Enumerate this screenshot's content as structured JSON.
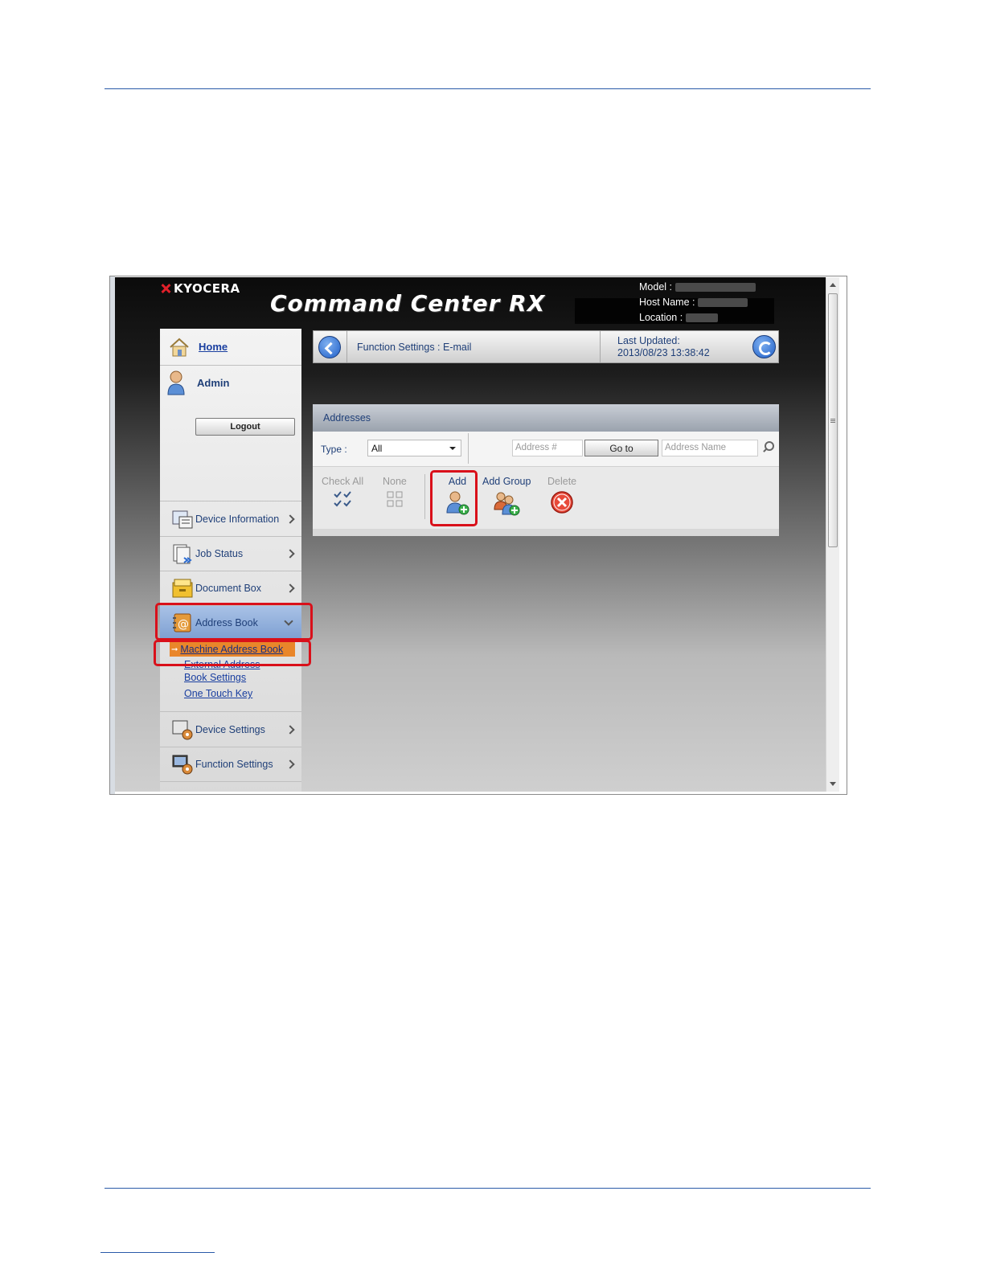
{
  "brand": {
    "logo_text": "KYOCERA",
    "product": "Command Center RX"
  },
  "device": {
    "model_label": "Model :",
    "host_label": "Host Name :",
    "location_label": "Location :"
  },
  "sidebar": {
    "home": "Home",
    "user": "Admin",
    "logout": "Logout",
    "items": [
      {
        "label": "Device Information",
        "icon": "device-information-icon"
      },
      {
        "label": "Job Status",
        "icon": "job-status-icon"
      },
      {
        "label": "Document Box",
        "icon": "document-box-icon"
      },
      {
        "label": "Address Book",
        "icon": "address-book-icon"
      },
      {
        "label": "Device Settings",
        "icon": "device-settings-icon"
      },
      {
        "label": "Function Settings",
        "icon": "function-settings-icon"
      }
    ],
    "address_book_links": {
      "current": "Machine Address Book",
      "external_line1": "External Address",
      "external_line2": "Book Settings",
      "one_touch": "One Touch Key"
    }
  },
  "topbar": {
    "breadcrumb": "Function Settings : E-mail",
    "updated_label": "Last Updated:",
    "updated_value": "2013/08/23 13:38:42"
  },
  "addresses": {
    "title": "Addresses",
    "type_label": "Type :",
    "type_value": "All",
    "address_num_placeholder": "Address #",
    "goto": "Go to",
    "address_name_placeholder": "Address Name",
    "tools": {
      "check_all": "Check All",
      "none": "None",
      "add": "Add",
      "add_group": "Add Group",
      "delete": "Delete"
    }
  },
  "colors": {
    "highlight": "#d9101a",
    "link": "#1a3fa0",
    "active_menu": "#e9862a",
    "accent": "#1f5fc8"
  }
}
